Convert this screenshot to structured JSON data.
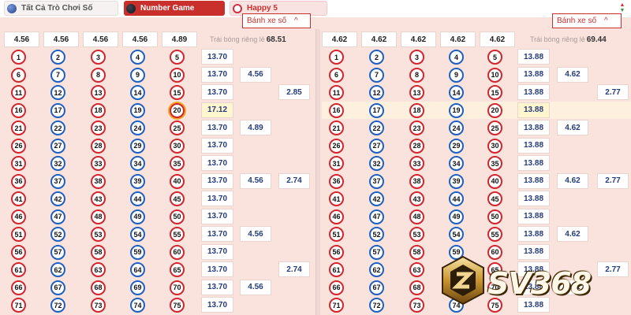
{
  "tabs": [
    {
      "label": "Tất Cả Trò Chơi Số",
      "active": false
    },
    {
      "label": "Number Game",
      "active": true
    },
    {
      "label": "Happy 5",
      "active": false
    }
  ],
  "wheel_label": "Bánh xe số",
  "colors": {
    "accent": "#c9302c",
    "ball_red": "#d2262e",
    "ball_blue": "#1f5fbf",
    "odds_text": "#253c7a",
    "background": "#fbe3dd"
  },
  "panels": [
    {
      "header_odds": [
        "4.56",
        "4.56",
        "4.56",
        "4.56",
        "4.89"
      ],
      "single_ball_label": "Trái bóng riêng lẻ",
      "single_ball_value": "68.51",
      "selected_ball": "20",
      "row_odds": [
        "13.70",
        "13.70",
        "13.70",
        "17.12",
        "13.70",
        "13.70",
        "13.70",
        "13.70",
        "13.70",
        "13.70",
        "13.70",
        "13.70",
        "13.70",
        "13.70",
        "13.70"
      ],
      "pair_odds": [
        "4.56",
        "4.89",
        "4.56",
        "4.56",
        "4.56"
      ],
      "group_odds": [
        "2.85",
        "2.74",
        "2.74"
      ]
    },
    {
      "header_odds": [
        "4.62",
        "4.62",
        "4.62",
        "4.62",
        "4.62"
      ],
      "single_ball_label": "Trái bóng riêng lẻ",
      "single_ball_value": "69.44",
      "highlighted_row": 3,
      "row_odds": [
        "13.88",
        "13.88",
        "13.88",
        "13.88",
        "13.88",
        "13.88",
        "13.88",
        "13.88",
        "13.88",
        "13.88",
        "13.88",
        "13.88",
        "13.88",
        "13.88",
        "13.88"
      ],
      "pair_odds": [
        "4.62",
        "4.62",
        "4.62",
        "4.62",
        "4.62"
      ],
      "group_odds": [
        "2.77",
        "2.77",
        "2.77"
      ]
    }
  ],
  "balls": [
    [
      "1",
      "2",
      "3",
      "4",
      "5"
    ],
    [
      "6",
      "7",
      "8",
      "9",
      "10"
    ],
    [
      "11",
      "12",
      "13",
      "14",
      "15"
    ],
    [
      "16",
      "17",
      "18",
      "19",
      "20"
    ],
    [
      "21",
      "22",
      "23",
      "24",
      "25"
    ],
    [
      "26",
      "27",
      "28",
      "29",
      "30"
    ],
    [
      "31",
      "32",
      "33",
      "34",
      "35"
    ],
    [
      "36",
      "37",
      "38",
      "39",
      "40"
    ],
    [
      "41",
      "42",
      "43",
      "44",
      "45"
    ],
    [
      "46",
      "47",
      "48",
      "49",
      "50"
    ],
    [
      "51",
      "52",
      "53",
      "54",
      "55"
    ],
    [
      "56",
      "57",
      "58",
      "59",
      "60"
    ],
    [
      "61",
      "62",
      "63",
      "64",
      "65"
    ],
    [
      "66",
      "67",
      "68",
      "69",
      "70"
    ],
    [
      "71",
      "72",
      "73",
      "74",
      "75"
    ]
  ],
  "watermark": "SV368"
}
